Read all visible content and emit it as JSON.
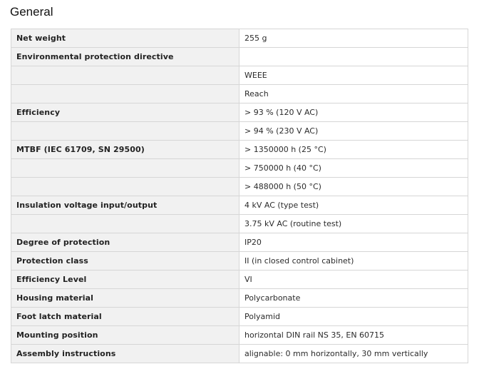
{
  "section": {
    "title": "General"
  },
  "rows": [
    {
      "label": "Net weight",
      "value": "255 g"
    },
    {
      "label": "Environmental protection directive",
      "value": ""
    },
    {
      "label": "",
      "value": "WEEE"
    },
    {
      "label": "",
      "value": "Reach"
    },
    {
      "label": "Efficiency",
      "value": "> 93 % (120 V AC)"
    },
    {
      "label": "",
      "value": "> 94 % (230 V AC)"
    },
    {
      "label": "MTBF (IEC 61709, SN 29500)",
      "value": "> 1350000 h (25 °C)"
    },
    {
      "label": "",
      "value": "> 750000 h (40 °C)"
    },
    {
      "label": "",
      "value": "> 488000 h (50 °C)"
    },
    {
      "label": "Insulation voltage input/output",
      "value": "4 kV AC (type test)"
    },
    {
      "label": "",
      "value": "3.75 kV AC (routine test)"
    },
    {
      "label": "Degree of protection",
      "value": "IP20"
    },
    {
      "label": "Protection class",
      "value": "II (in closed control cabinet)"
    },
    {
      "label": "Efficiency Level",
      "value": "VI"
    },
    {
      "label": "Housing material",
      "value": "Polycarbonate"
    },
    {
      "label": "Foot latch material",
      "value": "Polyamid"
    },
    {
      "label": "Mounting position",
      "value": "horizontal DIN rail NS 35, EN 60715"
    },
    {
      "label": "Assembly instructions",
      "value": "alignable: 0 mm horizontally, 30 mm vertically"
    }
  ]
}
